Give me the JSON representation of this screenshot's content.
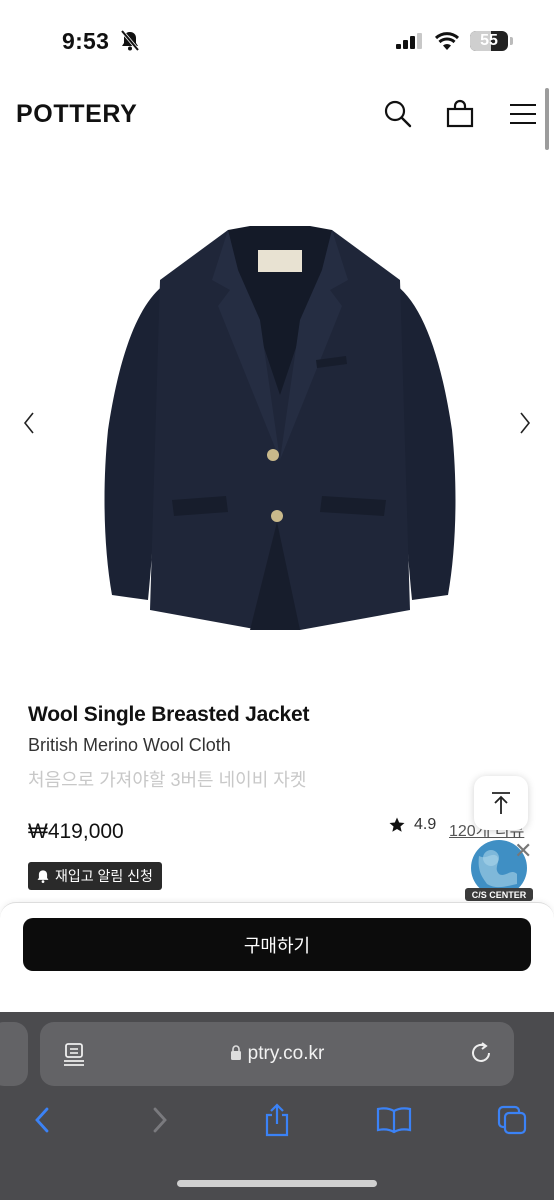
{
  "status_bar": {
    "time": "9:53",
    "battery": "55",
    "battery_level": 0.55
  },
  "header": {
    "logo": "POTTERY"
  },
  "product": {
    "name": "Wool Single Breasted Jacket",
    "subtitle": "British Merino Wool Cloth",
    "description": "처음으로 가져야할 3버튼 네이비 자켓",
    "price": "₩419,000",
    "rating": "4.9",
    "reviews_label": "120개 리뷰",
    "restock_label": "재입고 알림 신청"
  },
  "widgets": {
    "cs_center_label": "C/S CENTER"
  },
  "purchase": {
    "buy_label": "구매하기"
  },
  "browser": {
    "url": "ptry.co.kr"
  },
  "colors": {
    "jacket": "#1d2436",
    "button_bg": "#0c0c0c",
    "safari_bar": "#4b4b4e",
    "safari_accent": "#3b82f6"
  },
  "icons": [
    "bell-off-icon",
    "signal-icon",
    "wifi-icon",
    "search-icon",
    "shopping-bag-icon",
    "menu-icon",
    "chevron-left-icon",
    "chevron-right-icon",
    "star-icon",
    "bell-icon",
    "arrow-up-to-top-icon",
    "globe-icon",
    "close-icon",
    "reader-icon",
    "lock-icon",
    "reload-icon",
    "back-icon",
    "forward-icon",
    "share-icon",
    "bookmarks-icon",
    "tabs-icon"
  ]
}
